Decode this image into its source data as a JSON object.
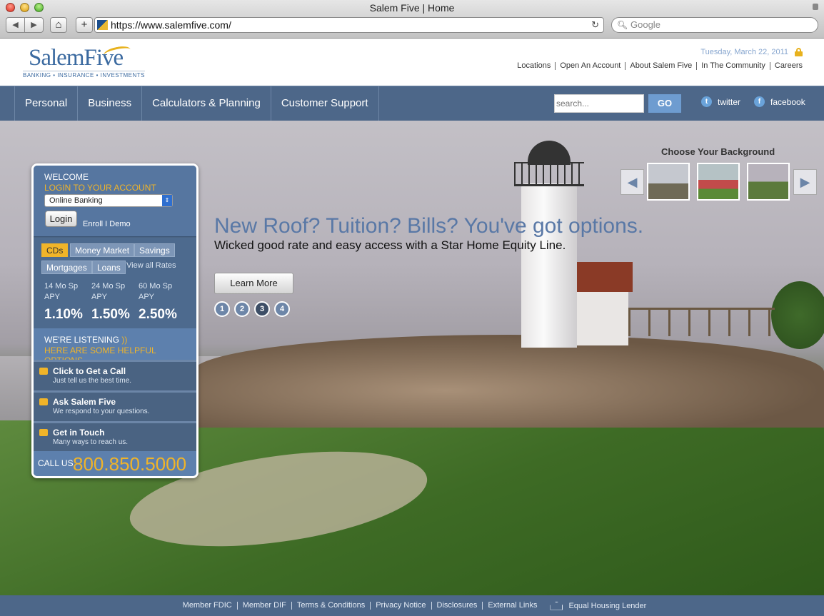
{
  "browser": {
    "window_title": "Salem Five | Home",
    "url": "https://www.salemfive.com/",
    "search_placeholder": "Google",
    "back_icon": "back-arrow-icon",
    "forward_icon": "forward-arrow-icon"
  },
  "header": {
    "logo_text": "SalemFive",
    "logo_tagline": "BANKING • INSURANCE • INVESTMENTS",
    "date": "Tuesday, March 22, 2011",
    "top_links": [
      "Locations",
      "Open An Account",
      "About Salem Five",
      "In The Community",
      "Careers"
    ]
  },
  "nav": {
    "items": [
      "Personal",
      "Business",
      "Calculators & Planning",
      "Customer Support"
    ],
    "search_placeholder": "search...",
    "go_label": "GO",
    "twitter_label": "twitter",
    "facebook_label": "facebook"
  },
  "login": {
    "welcome": "WELCOME",
    "login_label": "LOGIN TO YOUR ACCOUNT",
    "selected_account": "Online Banking",
    "login_button": "Login",
    "enroll_demo": "Enroll I Demo"
  },
  "rates": {
    "tabs": [
      "CDs",
      "Money Market",
      "Savings",
      "Mortgages",
      "Loans"
    ],
    "active_tab": "CDs",
    "view_all": "View all Rates",
    "columns": [
      {
        "term": "14 Mo Sp",
        "unit": "APY",
        "rate": "1.10%"
      },
      {
        "term": "24 Mo Sp",
        "unit": "APY",
        "rate": "1.50%"
      },
      {
        "term": "60 Mo Sp",
        "unit": "APY",
        "rate": "2.50%"
      }
    ]
  },
  "listening": {
    "title": "WE'RE LISTENING",
    "subtitle": "HERE ARE SOME HELPFUL OPTIONS",
    "options": [
      {
        "title": "Click to Get a Call",
        "desc": "Just tell us the best time.",
        "icon": "phone-icon"
      },
      {
        "title": "Ask Salem Five",
        "desc": "We respond to your questions.",
        "icon": "pencil-icon"
      },
      {
        "title": "Get in Touch",
        "desc": "Many ways to reach us.",
        "icon": "envelope-icon"
      }
    ],
    "call_us_label": "CALL US",
    "phone": "800.850.5000"
  },
  "promo": {
    "headline": "New Roof? Tuition? Bills? You've got options.",
    "subline": "Wicked good rate and easy access with a Star Home Equity Line.",
    "button": "Learn More",
    "pages": [
      "1",
      "2",
      "3",
      "4"
    ],
    "active_page": "3"
  },
  "background_chooser": {
    "title": "Choose Your Background"
  },
  "footer": {
    "links": [
      "Member FDIC",
      "Member DIF",
      "Terms & Conditions",
      "Privacy Notice",
      "Disclosures",
      "External Links"
    ],
    "equal_housing": "Equal Housing Lender"
  },
  "colors": {
    "brand_blue": "#4d6789",
    "accent_gold": "#f0b429"
  }
}
